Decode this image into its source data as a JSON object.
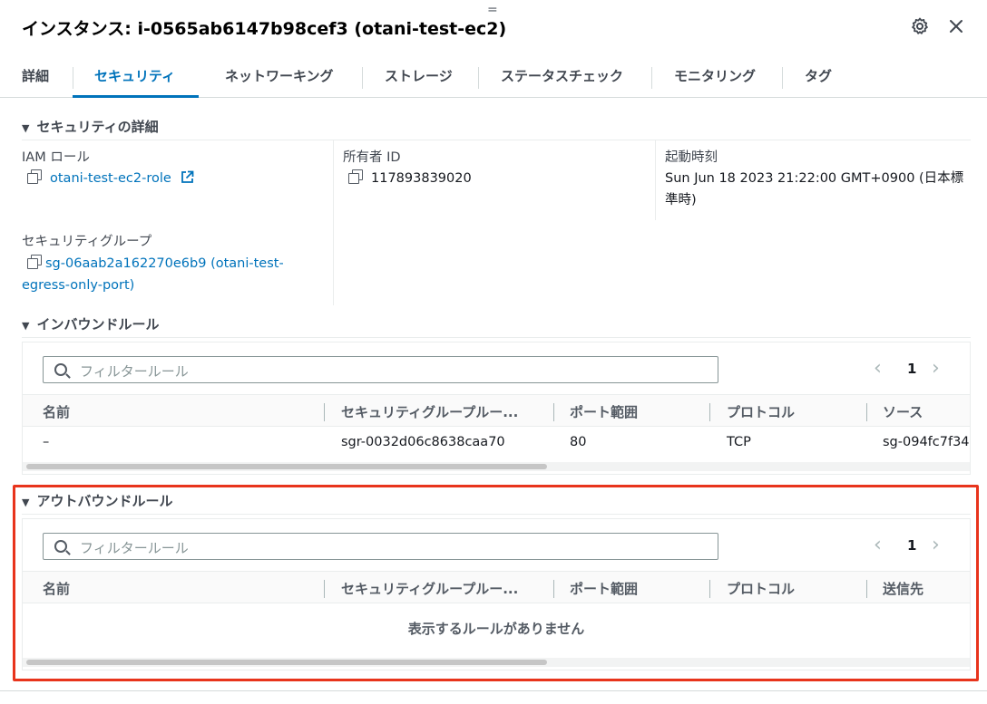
{
  "header": {
    "title": "インスタンス: i-0565ab6147b98cef3 (otani-test-ec2)",
    "drag_handle": "=",
    "settings_icon": "gear-icon",
    "close_icon": "close-icon"
  },
  "tabs": [
    {
      "label": "詳細"
    },
    {
      "label": "セキュリティ",
      "active": true
    },
    {
      "label": "ネットワーキング"
    },
    {
      "label": "ストレージ"
    },
    {
      "label": "ステータスチェック"
    },
    {
      "label": "モニタリング"
    },
    {
      "label": "タグ"
    }
  ],
  "security_details": {
    "heading": "セキュリティの詳細",
    "iam_role_label": "IAM ロール",
    "iam_role_value": "otani-test-ec2-role",
    "owner_label": "所有者 ID",
    "owner_value": "117893839020",
    "launch_time_label": "起動時刻",
    "launch_time_value_line1": "Sun Jun 18 2023 21:22:00 GMT+0900 (日本標",
    "launch_time_value_line2": "準時)",
    "sg_label": "セキュリティグループ",
    "sg_value_line1": "sg-06aab2a162270e6b9 (otani-test-",
    "sg_value_line2": "egress-only-port)"
  },
  "inbound": {
    "heading": "インバウンドルール",
    "search_placeholder": "フィルタールール",
    "page": "1",
    "columns": [
      "名前",
      "セキュリティグループルー...",
      "ポート範囲",
      "プロトコル",
      "ソース"
    ],
    "rows": [
      {
        "name": "–",
        "rule_id": "sgr-0032d06c8638caa70",
        "port": "80",
        "protocol": "TCP",
        "source": "sg-094fc7f34"
      }
    ]
  },
  "outbound": {
    "heading": "アウトバウンドルール",
    "search_placeholder": "フィルタールール",
    "page": "1",
    "columns": [
      "名前",
      "セキュリティグループルー...",
      "ポート範囲",
      "プロトコル",
      "送信先"
    ],
    "empty_message": "表示するルールがありません",
    "highlight_color": "#e8341c"
  },
  "colors": {
    "accent": "#0073bb",
    "highlight": "#e8341c"
  }
}
